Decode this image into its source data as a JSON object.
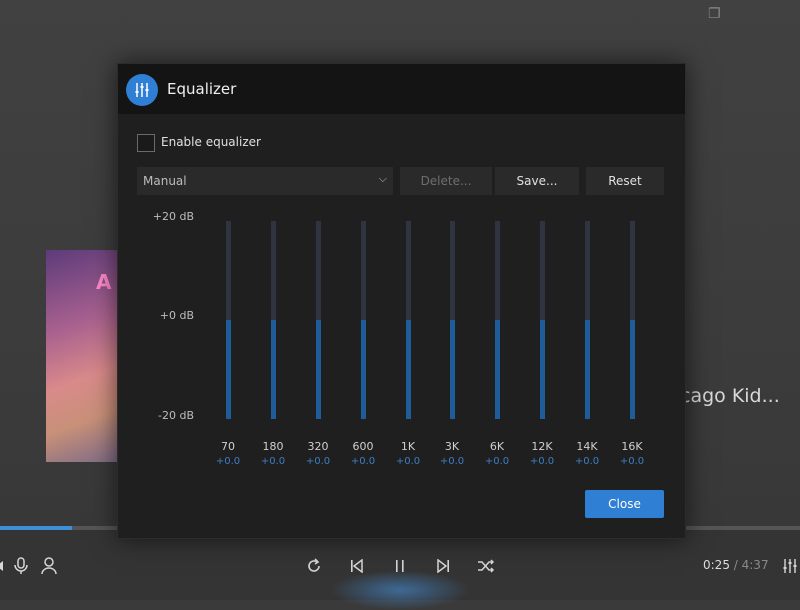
{
  "player": {
    "track_title": "cago Kid...",
    "album_letters": "A",
    "time_current": "0:25",
    "time_separator": " / ",
    "time_total": "4:37",
    "progress": 0.09,
    "accent_color": "#2f7fd4"
  },
  "equalizer": {
    "title": "Equalizer",
    "enable_label": "Enable equalizer",
    "enabled": false,
    "preset": "Manual",
    "delete_label": "Delete...",
    "save_label": "Save...",
    "reset_label": "Reset",
    "close_label": "Close",
    "db_top": "+20 dB",
    "db_mid": "+0 dB",
    "db_bottom": "-20 dB",
    "bands": [
      {
        "freq": "70",
        "gain": "+0.0",
        "value": 0
      },
      {
        "freq": "180",
        "gain": "+0.0",
        "value": 0
      },
      {
        "freq": "320",
        "gain": "+0.0",
        "value": 0
      },
      {
        "freq": "600",
        "gain": "+0.0",
        "value": 0
      },
      {
        "freq": "1K",
        "gain": "+0.0",
        "value": 0
      },
      {
        "freq": "3K",
        "gain": "+0.0",
        "value": 0
      },
      {
        "freq": "6K",
        "gain": "+0.0",
        "value": 0
      },
      {
        "freq": "12K",
        "gain": "+0.0",
        "value": 0
      },
      {
        "freq": "14K",
        "gain": "+0.0",
        "value": 0
      },
      {
        "freq": "16K",
        "gain": "+0.0",
        "value": 0
      }
    ]
  }
}
